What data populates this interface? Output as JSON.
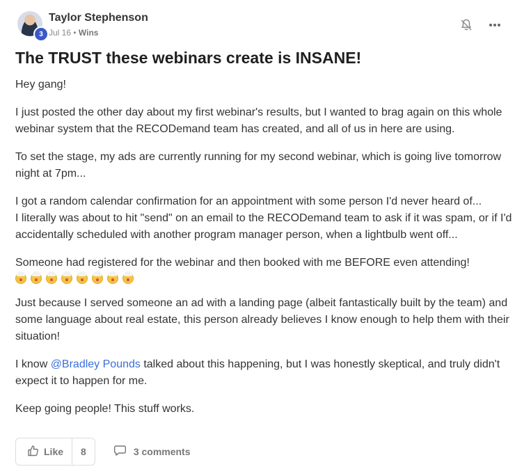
{
  "post": {
    "author": {
      "name": "Taylor Stephenson",
      "level": "3"
    },
    "date": "Jul 16",
    "separator": "•",
    "category": "Wins",
    "title": "The TRUST these webinars create is INSANE!",
    "paragraphs": [
      "Hey gang!",
      "I just posted the other day about my first webinar's results, but I wanted to brag again on this whole webinar system that the RECODemand team has created, and all of us in here are using.",
      "To set the stage, my ads are currently running for my second webinar, which is going live tomorrow night at 7pm...",
      "I got a random calendar confirmation for an appointment with some person I'd never heard of...\nI literally was about to hit \"send\" on an email to the RECODemand team to ask if it was spam, or if I'd accidentally scheduled with another program manager person, when a lightbulb went off...",
      "Someone had registered for the webinar and then booked with me BEFORE even attending!",
      "Just because I served someone an ad with a landing page (albeit fantastically built by the team) and some language about real estate, this person already believes I know enough to help them with their situation!"
    ],
    "mention_paragraph": {
      "before": "I know ",
      "mention": "@Bradley Pounds",
      "after": " talked about this happening, but I was honestly skeptical, and truly didn't expect it to happen for me."
    },
    "closing": "Keep going people! This stuff works.",
    "emoji": {
      "name": "exploding-head-emoji",
      "count": 8
    },
    "actions": {
      "like_label": "Like",
      "like_count": "8",
      "comments_label": "3 comments"
    },
    "icons": [
      "bell-off-icon",
      "more-icon",
      "thumbs-up-icon",
      "comment-icon"
    ],
    "colors": {
      "mention": "#3a6fd8",
      "level_badge": "#3a5bc7"
    }
  }
}
